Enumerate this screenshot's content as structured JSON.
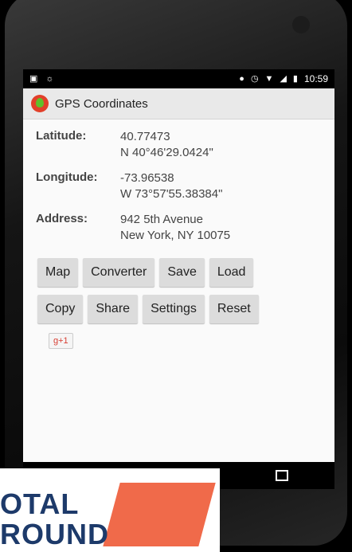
{
  "status_bar": {
    "time": "10:59"
  },
  "app": {
    "title": "GPS Coordinates"
  },
  "latitude": {
    "label": "Latitude:",
    "decimal": "40.77473",
    "dms": "N 40°46'29.0424\""
  },
  "longitude": {
    "label": "Longitude:",
    "decimal": "-73.96538",
    "dms": "W 73°57'55.38384\""
  },
  "address": {
    "label": "Address:",
    "line1": "942 5th Avenue",
    "line2": "New York, NY 10075"
  },
  "buttons_row1": [
    "Map",
    "Converter",
    "Save",
    "Load"
  ],
  "buttons_row2": [
    "Copy",
    "Share",
    "Settings",
    "Reset"
  ],
  "gplus": {
    "label": "g+1"
  },
  "brand": {
    "line1": "OTAL",
    "line2": "ROUND"
  },
  "colors": {
    "brand_accent": "#f06a4a",
    "brand_text": "#1d3a6a",
    "app_logo": "#e2402a"
  }
}
